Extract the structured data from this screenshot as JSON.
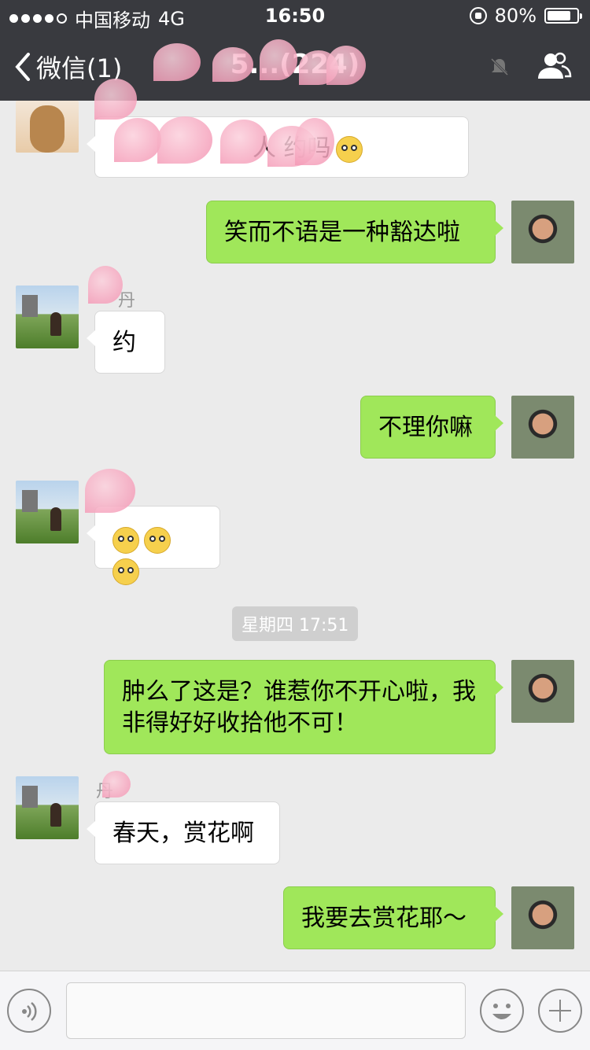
{
  "status_bar": {
    "carrier": "中国移动",
    "network": "4G",
    "time": "16:50",
    "battery": "80%",
    "battery_level": 0.8
  },
  "nav": {
    "back_label": "微信(1)",
    "title": "5...(224)",
    "icons": [
      "chevron-left-icon",
      "mute-icon",
      "group-members-icon"
    ]
  },
  "messages": [
    {
      "side": "left",
      "text": "人 约吗"
    },
    {
      "side": "right",
      "text": "笑而不语是一种豁达啦"
    },
    {
      "side": "left",
      "sender": "丹",
      "text": "约"
    },
    {
      "side": "right",
      "text": "不理你嘛"
    },
    {
      "side": "left",
      "text": "",
      "emoji": [
        "pleading-emoji",
        "pleading-emoji",
        "pleading-emoji"
      ]
    },
    {
      "side": "right",
      "text": "肿么了这是？谁惹你不开心啦，我非得好好收拾他不可！"
    },
    {
      "side": "left",
      "sender": "丹",
      "text": "春天，赏花啊"
    },
    {
      "side": "right",
      "text": "我要去赏花耶～"
    }
  ],
  "timestamp": "星期四 17:51",
  "input_bar": {
    "placeholder": "",
    "icons": [
      "voice-icon",
      "emoji-icon",
      "plus-icon"
    ]
  },
  "colors": {
    "nav_bg": "#393a3f",
    "chat_bg": "#ebebeb",
    "bubble_out": "#a0e75a",
    "bubble_in": "#ffffff"
  }
}
